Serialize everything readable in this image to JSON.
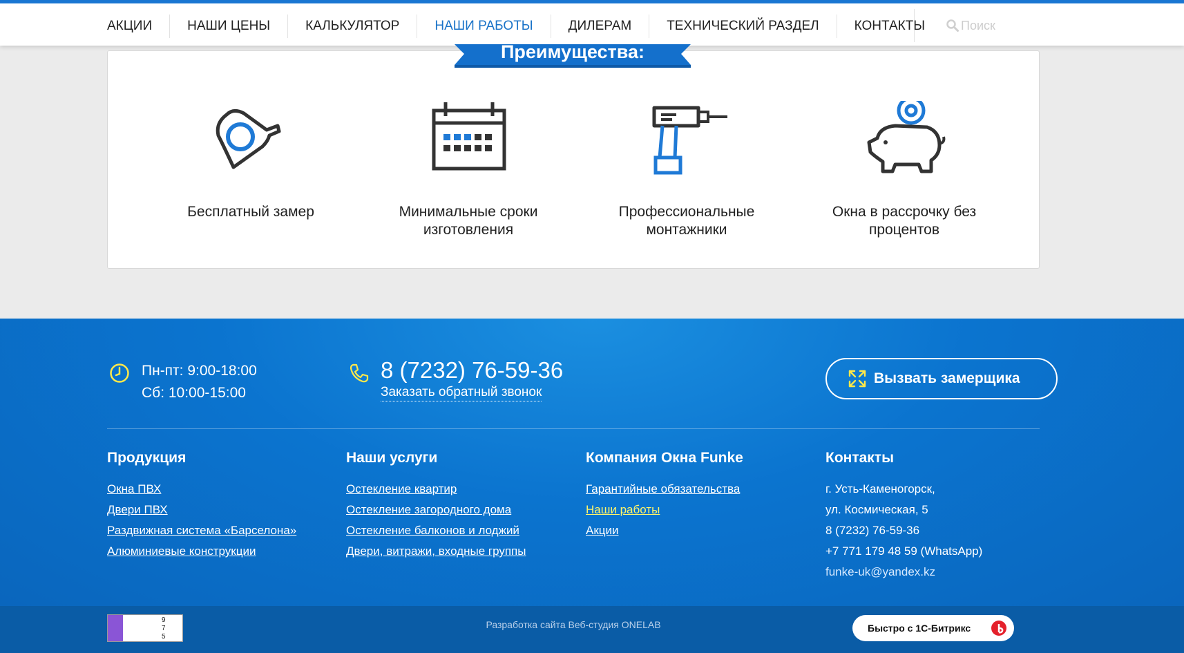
{
  "nav": {
    "items": [
      {
        "label": "АКЦИИ"
      },
      {
        "label": "НАШИ ЦЕНЫ"
      },
      {
        "label": "КАЛЬКУЛЯТОР"
      },
      {
        "label": "НАШИ РАБОТЫ",
        "active": true
      },
      {
        "label": "ДИЛЕРАМ"
      },
      {
        "label": "ТЕХНИЧЕСКИЙ РАЗДЕЛ"
      },
      {
        "label": "КОНТАКТЫ"
      }
    ],
    "search_placeholder": "Поиск"
  },
  "advantages": {
    "title": "Преимущества:",
    "items": [
      {
        "icon": "tape-measure-icon",
        "label": "Бесплатный замер"
      },
      {
        "icon": "calendar-icon",
        "label": "Минимальные сроки изготовления"
      },
      {
        "icon": "drill-icon",
        "label": "Профессиональные монтажники"
      },
      {
        "icon": "piggy-bank-icon",
        "label": "Окна в рассрочку без процентов"
      }
    ]
  },
  "footer": {
    "hours_weekday": "Пн-пт: 9:00-18:00",
    "hours_saturday": "Сб: 10:00-15:00",
    "phone": "8 (7232) 76-59-36",
    "callback_label": "Заказать обратный звонок",
    "measure_button": "Вызвать замерщика",
    "columns": {
      "products": {
        "title": "Продукция",
        "links": [
          "Окна ПВХ",
          "Двери ПВХ",
          "Раздвижная система «Барселона»",
          "Алюминиевые конструкции"
        ]
      },
      "services": {
        "title": "Наши услуги",
        "links": [
          "Остекление квартир",
          "Остекление загородного дома",
          "Остекление балконов и лоджий",
          "Двери, витражи, входные группы"
        ]
      },
      "company": {
        "title": "Компания Окна Funke",
        "links": [
          "Гарантийные обязательства",
          "Наши работы",
          "Акции"
        ]
      },
      "contacts": {
        "title": "Контакты",
        "address_line1": "г. Усть-Каменогорск,",
        "address_line2": "ул. Космическая, 5",
        "phone": "8 (7232) 76-59-36",
        "whatsapp": "+7 771 179 48 59 (WhatsApp)",
        "email": "funke-uk@yandex.kz"
      }
    },
    "developer": "Разработка сайта Веб-студия ONELAB",
    "counter_values": [
      "9",
      "7",
      "5"
    ],
    "bitrix_label": "Быстро с 1С-Битрикс"
  },
  "colors": {
    "accent": "#1976d2",
    "icon_blue": "#1f7ad6",
    "icon_dark": "#333333",
    "footer_blue": "#0b74cf",
    "highlight_yellow": "#fff56a"
  }
}
